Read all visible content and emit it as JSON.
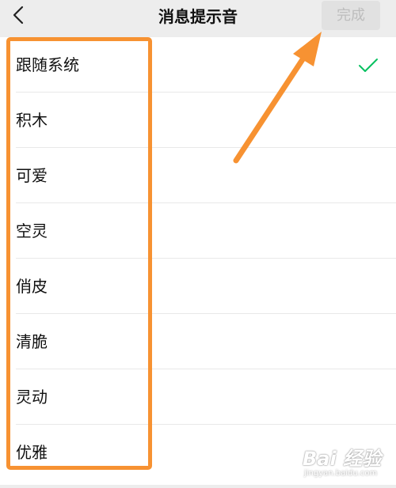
{
  "header": {
    "title": "消息提示音",
    "done_label": "完成",
    "back_icon": "chevron-left-icon"
  },
  "sounds": {
    "items": [
      {
        "label": "跟随系统",
        "selected": true
      },
      {
        "label": "积木",
        "selected": false
      },
      {
        "label": "可爱",
        "selected": false
      },
      {
        "label": "空灵",
        "selected": false
      },
      {
        "label": "俏皮",
        "selected": false
      },
      {
        "label": "清脆",
        "selected": false
      },
      {
        "label": "灵动",
        "selected": false
      },
      {
        "label": "优雅",
        "selected": false
      }
    ],
    "check_icon": "checkmark-icon",
    "check_color": "#07c160"
  },
  "annotation": {
    "color": "#f79232"
  },
  "watermark": {
    "main": "Bai 经验",
    "sub": "jingyan.baidu.com"
  }
}
